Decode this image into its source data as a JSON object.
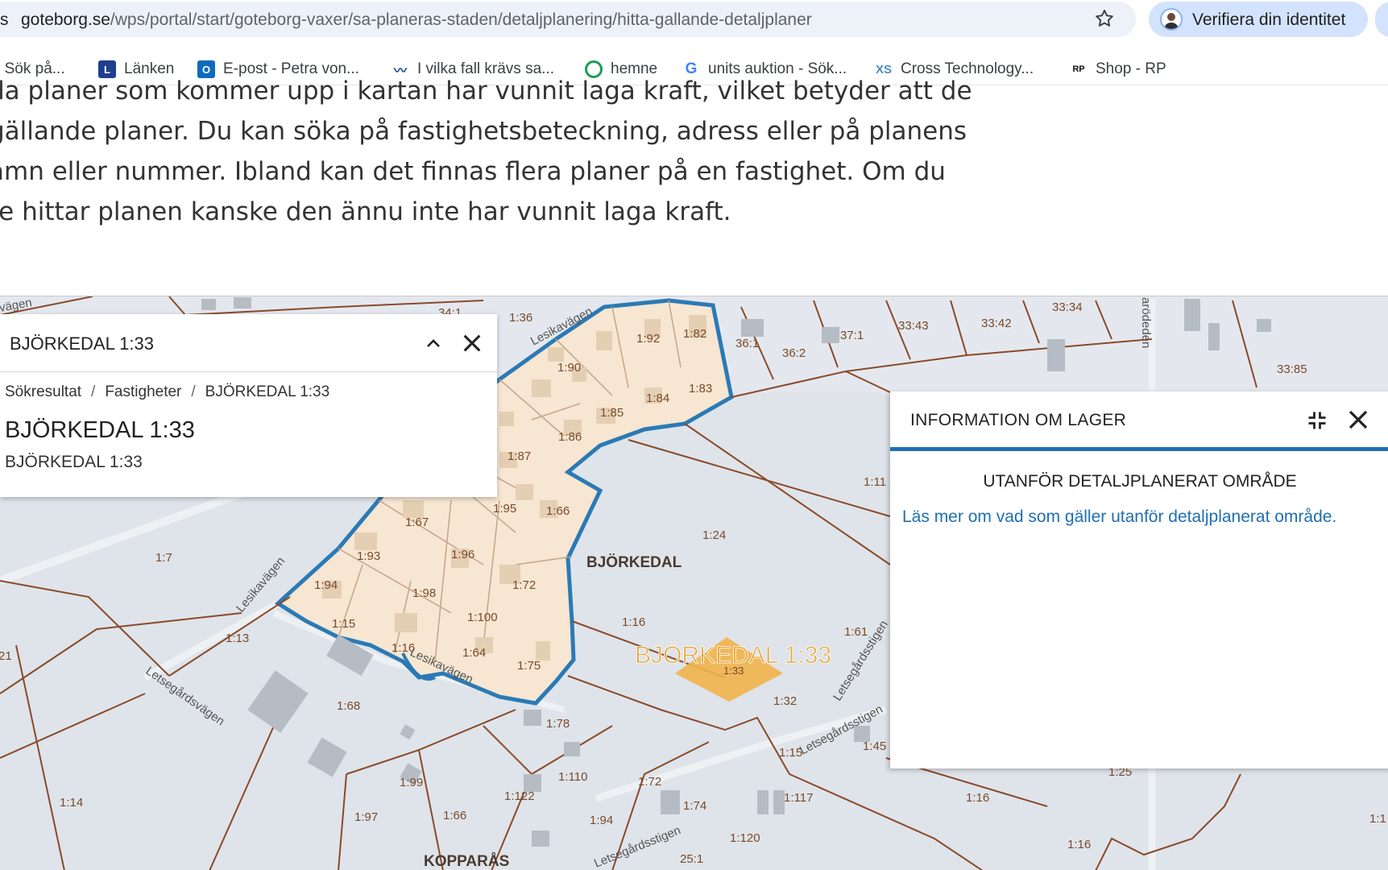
{
  "browser": {
    "url_prefix": "s",
    "url_host": "goteborg.se",
    "url_path": "/wps/portal/start/goteborg-vaxer/sa-planeras-staden/detaljplanering/hitta-gallande-detaljplaner",
    "verify_label": "Verifiera din identitet",
    "bookmarks": [
      {
        "label": "- Sök på...",
        "icon": "bookmark-icon"
      },
      {
        "label": "Länken",
        "icon": "lanken-icon"
      },
      {
        "label": "E-post - Petra von...",
        "icon": "outlook-icon"
      },
      {
        "label": "I vilka fall krävs sa...",
        "icon": "wave-icon"
      },
      {
        "label": "hemne",
        "icon": "hemne-icon"
      },
      {
        "label": "units auktion - Sök...",
        "icon": "google-icon"
      },
      {
        "label": "Cross Technology...",
        "icon": "cross-tech-icon"
      },
      {
        "label": "Shop - RP",
        "icon": "rp-icon"
      }
    ]
  },
  "intro": {
    "line1": "da planer som kommer upp i kartan har vunnit laga kraft, vilket betyder att de",
    "line2": "gällande planer. Du kan söka på fastighetsbeteckning, adress eller på planens",
    "line3": "amn eller nummer. Ibland kan det finnas flera planer på en fastighet. Om du",
    "line4": "te hittar planen kanske den ännu inte har vunnit laga kraft."
  },
  "left_panel": {
    "title": "BJÖRKEDAL 1:33",
    "breadcrumb": [
      "Sökresultat",
      "Fastigheter",
      "BJÖRKEDAL 1:33"
    ],
    "heading": "BJÖRKEDAL 1:33",
    "subheading": "BJÖRKEDAL 1:33"
  },
  "right_panel": {
    "title": "INFORMATION OM LAGER",
    "heading": "UTANFÖR DETALJPLANERAT OMRÅDE",
    "link_text": "Läs mer om vad som gäller utanför detaljplanerat område."
  },
  "map": {
    "highlight_label": "BJÖRKEDAL 1:33",
    "highlight_parcel": "1:33",
    "area_labels": [
      "BJÖRKEDAL",
      "KOPPARÅS"
    ],
    "road_labels": [
      "Lesikavägen",
      "Letsegårdsvägen",
      "Letsegårdsstigen",
      "arödeden",
      "vägen",
      "Lesikavägen",
      "Letsegårdsstigen"
    ],
    "parcels": [
      "1:36",
      "34:1",
      "1:92",
      "1:82",
      "1:90",
      "36:1",
      "36:2",
      "37:1",
      "33:43",
      "33:42",
      "33:34",
      "33:85",
      "1:84",
      "1:83",
      "1:85",
      "1:86",
      "1:87",
      "1:95",
      "1:66",
      "1:67",
      "1:96",
      "1:93",
      "1:7",
      "1:94",
      "1:98",
      "1:72",
      "1:100",
      "1:15",
      "1:13",
      "1:16",
      "1:64",
      "1:75",
      "1:24",
      "1:16",
      "1:11",
      "1:61",
      "1:32",
      "1:68",
      "1:78",
      "1:15",
      "1:45",
      "1:99",
      "1:110",
      "1:72",
      "1:122",
      "1:14",
      "1:97",
      "1:66",
      "1:94",
      "1:74",
      "1:117",
      "1:120",
      "25:1",
      "1:16",
      "1:25",
      "1:16",
      "1:1",
      "1:15",
      "21"
    ],
    "colors": {
      "plan_fill": "#f6e6d2",
      "plan_border": "#2b7ab5",
      "parcel_line": "#8a4a2a",
      "highlight": "#f1b24a",
      "highlight_text": "#e6a43a"
    }
  }
}
